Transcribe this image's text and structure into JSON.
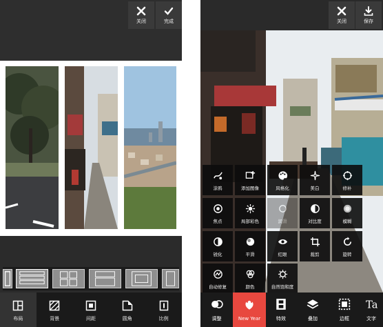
{
  "colors": {
    "accent": "#e8483f",
    "dark": "#1a1a1a",
    "tile": "#0c0c0c"
  },
  "left": {
    "top": {
      "close_label": "关闭",
      "done_label": "完成"
    },
    "tabs": [
      {
        "label": "布局",
        "icon": "layout-icon"
      },
      {
        "label": "背景",
        "icon": "background-icon"
      },
      {
        "label": "间距",
        "icon": "spacing-icon"
      },
      {
        "label": "圆角",
        "icon": "corner-icon"
      },
      {
        "label": "比例",
        "icon": "ratio-icon"
      }
    ],
    "active_tab": 0
  },
  "right": {
    "top": {
      "close_label": "关闭",
      "save_label": "保存"
    },
    "effects": [
      {
        "label": "涂鸦",
        "icon": "doodle-icon"
      },
      {
        "label": "添加图像",
        "icon": "add-image-icon"
      },
      {
        "label": "风格化",
        "icon": "palette-icon"
      },
      {
        "label": "美白",
        "icon": "sparkle-icon"
      },
      {
        "label": "修补",
        "icon": "crosshair-icon"
      },
      {
        "label": "焦点",
        "icon": "focus-icon"
      },
      {
        "label": "局部彩色",
        "icon": "color-splash-icon"
      },
      {
        "label": "润滑",
        "icon": "smooth-icon"
      },
      {
        "label": "对比度",
        "icon": "contrast-icon"
      },
      {
        "label": "模糊",
        "icon": "blur-icon"
      },
      {
        "label": "锐化",
        "icon": "sharpen-icon"
      },
      {
        "label": "平滑",
        "icon": "soften-icon"
      },
      {
        "label": "红眼",
        "icon": "eye-icon"
      },
      {
        "label": "裁剪",
        "icon": "crop-icon"
      },
      {
        "label": "旋转",
        "icon": "rotate-icon"
      },
      {
        "label": "自动修复",
        "icon": "auto-fix-icon"
      },
      {
        "label": "颜色",
        "icon": "color-icon"
      },
      {
        "label": "自然饱和度",
        "icon": "vibrance-icon"
      }
    ],
    "tabs": [
      {
        "label": "调整",
        "icon": "adjust-icon"
      },
      {
        "label": "New Year",
        "icon": "new-year-icon"
      },
      {
        "label": "特效",
        "icon": "film-icon"
      },
      {
        "label": "叠加",
        "icon": "layers-icon"
      },
      {
        "label": "边框",
        "icon": "frame-icon"
      },
      {
        "label": "文字",
        "icon": "text-icon"
      }
    ],
    "active_tab": 1
  }
}
